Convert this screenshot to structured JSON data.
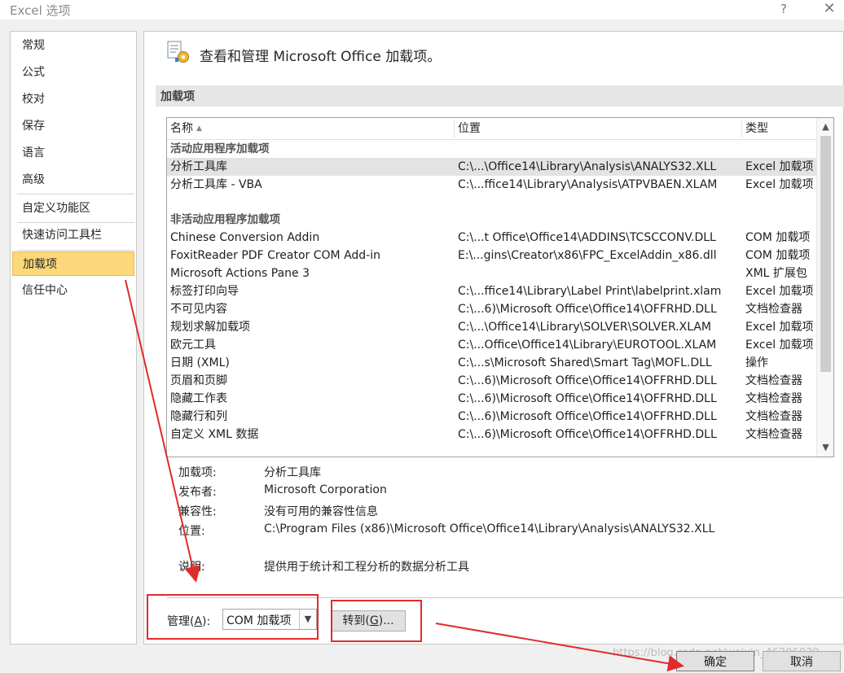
{
  "window": {
    "title": "Excel 选项",
    "help": "?",
    "close": "✕"
  },
  "nav": {
    "items": [
      {
        "label": "常规"
      },
      {
        "label": "公式"
      },
      {
        "label": "校对"
      },
      {
        "label": "保存"
      },
      {
        "label": "语言"
      },
      {
        "label": "高级"
      },
      {
        "label": "自定义功能区"
      },
      {
        "label": "快速访问工具栏"
      },
      {
        "label": "加载项",
        "active": true
      },
      {
        "label": "信任中心"
      }
    ]
  },
  "header": {
    "text": "查看和管理 Microsoft Office 加载项。"
  },
  "section": {
    "label": "加载项"
  },
  "table": {
    "columns": [
      "名称",
      "位置",
      "类型"
    ],
    "groups": [
      {
        "label": "活动应用程序加载项",
        "rows": [
          {
            "name": "分析工具库",
            "location": "C:\\...\\Office14\\Library\\Analysis\\ANALYS32.XLL",
            "type": "Excel 加载项",
            "selected": true
          },
          {
            "name": "分析工具库 - VBA",
            "location": "C:\\...ffice14\\Library\\Analysis\\ATPVBAEN.XLAM",
            "type": "Excel 加载项"
          }
        ]
      },
      {
        "label": "非活动应用程序加载项",
        "rows": [
          {
            "name": "Chinese Conversion Addin",
            "location": "C:\\...t Office\\Office14\\ADDINS\\TCSCCONV.DLL",
            "type": "COM 加载项"
          },
          {
            "name": "FoxitReader PDF Creator COM Add-in",
            "location": "E:\\...gins\\Creator\\x86\\FPC_ExcelAddin_x86.dll",
            "type": "COM 加载项"
          },
          {
            "name": "Microsoft Actions Pane 3",
            "location": "",
            "type": "XML 扩展包"
          },
          {
            "name": "标签打印向导",
            "location": "C:\\...ffice14\\Library\\Label Print\\labelprint.xlam",
            "type": "Excel 加载项"
          },
          {
            "name": "不可见内容",
            "location": "C:\\...6)\\Microsoft Office\\Office14\\OFFRHD.DLL",
            "type": "文档检查器"
          },
          {
            "name": "规划求解加载项",
            "location": "C:\\...\\Office14\\Library\\SOLVER\\SOLVER.XLAM",
            "type": "Excel 加载项"
          },
          {
            "name": "欧元工具",
            "location": "C:\\...Office\\Office14\\Library\\EUROTOOL.XLAM",
            "type": "Excel 加载项"
          },
          {
            "name": "日期 (XML)",
            "location": "C:\\...s\\Microsoft Shared\\Smart Tag\\MOFL.DLL",
            "type": "操作"
          },
          {
            "name": "页眉和页脚",
            "location": "C:\\...6)\\Microsoft Office\\Office14\\OFFRHD.DLL",
            "type": "文档检查器"
          },
          {
            "name": "隐藏工作表",
            "location": "C:\\...6)\\Microsoft Office\\Office14\\OFFRHD.DLL",
            "type": "文档检查器"
          },
          {
            "name": "隐藏行和列",
            "location": "C:\\...6)\\Microsoft Office\\Office14\\OFFRHD.DLL",
            "type": "文档检查器"
          },
          {
            "name": "自定义 XML 数据",
            "location": "C:\\...6)\\Microsoft Office\\Office14\\OFFRHD.DLL",
            "type": "文档检查器"
          }
        ]
      }
    ]
  },
  "details": {
    "addin_label": "加载项:",
    "addin_value": "分析工具库",
    "publisher_label": "发布者:",
    "publisher_value": "Microsoft Corporation",
    "compat_label": "兼容性:",
    "compat_value": "没有可用的兼容性信息",
    "location_label": "位置:",
    "location_value": "C:\\Program Files (x86)\\Microsoft Office\\Office14\\Library\\Analysis\\ANALYS32.XLL",
    "desc_label": "说明:",
    "desc_value": "提供用于统计和工程分析的数据分析工具"
  },
  "manage": {
    "label_prefix": "管理(",
    "label_key": "A",
    "label_suffix": "):",
    "selected": "COM 加载项"
  },
  "goto": {
    "prefix": "转到(",
    "key": "G",
    "suffix": ")..."
  },
  "footer": {
    "ok": "确定",
    "cancel": "取消"
  },
  "watermark": "https://blog.csdn.net/weixin_46206039",
  "colors": {
    "active_nav": "#fcd87a",
    "annotation": "#e02b2b"
  },
  "icons": {
    "header": "addins-gear-icon",
    "sort": "sort-up-arrow-icon",
    "scroll_up": "chevron-up-icon",
    "scroll_down": "chevron-down-icon",
    "dropdown": "chevron-down-icon"
  }
}
